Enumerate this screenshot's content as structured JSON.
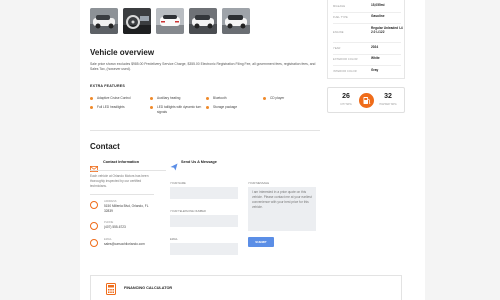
{
  "specs": [
    {
      "label": "Mileage",
      "value": "15,055mi"
    },
    {
      "label": "Fuel type",
      "value": "Gasoline"
    },
    {
      "label": "Engine",
      "value": "Regular Unleaded I-4 2.0 L/122"
    },
    {
      "label": "Year",
      "value": "2024"
    },
    {
      "label": "Exterior color",
      "value": "White"
    },
    {
      "label": "Interior color",
      "value": "Gray"
    }
  ],
  "fuel": {
    "city_value": "26",
    "city_label": "City MPG",
    "hwy_value": "32",
    "hwy_label": "Highway MPG",
    "icon": "gas-pump-icon",
    "accent": "#ef6c1a"
  },
  "overview": {
    "title": "Vehicle overview",
    "text": "Sale price shown excludes $985.00 Predelivery Service Charge, $355.00 Electronic Registration Filing Fee, all government fees, registration fees, and Sales Tax, (however used)."
  },
  "features": {
    "title": "Extra Features",
    "items": [
      "Adaptive Cruise Control",
      "Auxiliary heating",
      "Bluetooth",
      "CD player",
      "Full LED headlights",
      "LED taillights with dynamic turn signals",
      "Storage package"
    ]
  },
  "contact": {
    "title": "Contact",
    "info_tab": "Contact Information",
    "message_tab": "Send Us A Message",
    "intro": "Each vehicle at Orlando Motors has been thoroughly inspected by our certified technicians.",
    "address_label": "Address",
    "address": "5150 Millenia Blvd, Orlando, FL 32839",
    "phone_label": "Phone",
    "phone": "(407) 555-6723",
    "email_label": "Email",
    "email": "sales@carsochilorlando.com"
  },
  "form": {
    "name_label": "Your name",
    "phone_label": "Your telephone number",
    "email_label": "Email",
    "message_label": "Your message",
    "message_value": "I am interested in a price quote on this vehicle. Please contact me at your earliest convenience with your best price for this vehicle.",
    "submit": "Submit"
  },
  "calculator": {
    "title": "Financing Calculator"
  }
}
